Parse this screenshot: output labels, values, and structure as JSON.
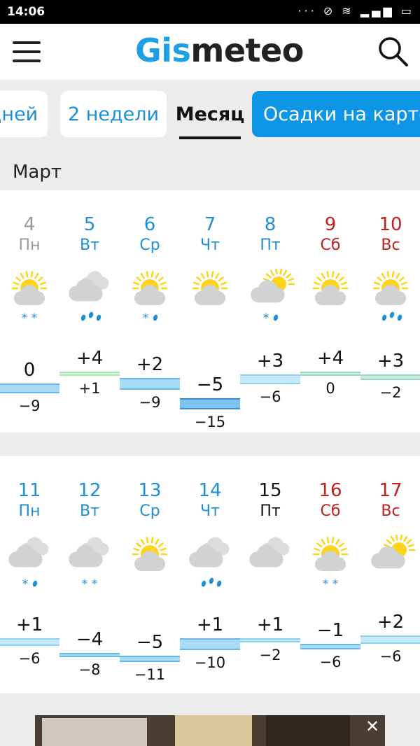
{
  "status_bar": {
    "time": "14:06",
    "icons": "··· ⊘ ≋ ▂▄▆ ▭"
  },
  "header": {
    "logo_part1": "Gis",
    "logo_part2": "meteo"
  },
  "tabs": [
    {
      "label": "дней",
      "active": false
    },
    {
      "label": "2 недели",
      "active": false
    },
    {
      "label": "Месяц",
      "active": true
    },
    {
      "label": "Осадки на карте",
      "active": false
    }
  ],
  "month": "Март",
  "colors": {
    "weekday": "#1e8fd2",
    "weekend": "#c0201e",
    "past": "#999999",
    "today": "#111111",
    "sun": "#ffd31a",
    "cloud": "#d0d2d4",
    "precip": "#1e8fd2"
  },
  "weeks": [
    {
      "days": [
        {
          "date": "4",
          "dow": "Пн",
          "kind": "past",
          "icon": "sun-cloud",
          "precip": "snow",
          "tmax": "0",
          "tmin": "−9",
          "tmax_v": 0,
          "tmin_v": -9
        },
        {
          "date": "5",
          "dow": "Вт",
          "kind": "weekday",
          "icon": "clouds",
          "precip": "rain",
          "tmax": "+4",
          "tmin": "+1",
          "tmax_v": 4,
          "tmin_v": 1
        },
        {
          "date": "6",
          "dow": "Ср",
          "kind": "weekday",
          "icon": "sun-cloud",
          "precip": "snow-rain",
          "tmax": "+2",
          "tmin": "−9",
          "tmax_v": 2,
          "tmin_v": -9
        },
        {
          "date": "7",
          "dow": "Чт",
          "kind": "weekday",
          "icon": "sun-cloud",
          "precip": "none",
          "tmax": "−5",
          "tmin": "−15",
          "tmax_v": -5,
          "tmin_v": -15
        },
        {
          "date": "8",
          "dow": "Пт",
          "kind": "weekday",
          "icon": "cloud-sun",
          "precip": "snow-rain",
          "tmax": "+3",
          "tmin": "−6",
          "tmax_v": 3,
          "tmin_v": -6
        },
        {
          "date": "9",
          "dow": "Сб",
          "kind": "weekend",
          "icon": "sun-cloud",
          "precip": "none",
          "tmax": "+4",
          "tmin": "0",
          "tmax_v": 4,
          "tmin_v": 0
        },
        {
          "date": "10",
          "dow": "Вс",
          "kind": "weekend",
          "icon": "sun-cloud",
          "precip": "rain",
          "tmax": "+3",
          "tmin": "−2",
          "tmax_v": 3,
          "tmin_v": -2
        }
      ]
    },
    {
      "days": [
        {
          "date": "11",
          "dow": "Пн",
          "kind": "weekday",
          "icon": "clouds",
          "precip": "snow-rain",
          "tmax": "+1",
          "tmin": "−6",
          "tmax_v": 1,
          "tmin_v": -6
        },
        {
          "date": "12",
          "dow": "Вт",
          "kind": "weekday",
          "icon": "clouds",
          "precip": "snow",
          "tmax": "−4",
          "tmin": "−8",
          "tmax_v": -4,
          "tmin_v": -8
        },
        {
          "date": "13",
          "dow": "Ср",
          "kind": "weekday",
          "icon": "sun-cloud",
          "precip": "none",
          "tmax": "−5",
          "tmin": "−11",
          "tmax_v": -5,
          "tmin_v": -11
        },
        {
          "date": "14",
          "dow": "Чт",
          "kind": "weekday",
          "icon": "clouds",
          "precip": "rain",
          "tmax": "+1",
          "tmin": "−10",
          "tmax_v": 1,
          "tmin_v": -10
        },
        {
          "date": "15",
          "dow": "Пт",
          "kind": "today",
          "icon": "clouds",
          "precip": "none",
          "tmax": "+1",
          "tmin": "−2",
          "tmax_v": 1,
          "tmin_v": -2
        },
        {
          "date": "16",
          "dow": "Сб",
          "kind": "weekend",
          "icon": "sun-cloud",
          "precip": "snow",
          "tmax": "−1",
          "tmin": "−6",
          "tmax_v": -1,
          "tmin_v": -6
        },
        {
          "date": "17",
          "dow": "Вс",
          "kind": "weekend",
          "icon": "cloud-sun",
          "precip": "none",
          "tmax": "+2",
          "tmin": "−6",
          "tmax_v": 2,
          "tmin_v": -6
        }
      ]
    }
  ]
}
